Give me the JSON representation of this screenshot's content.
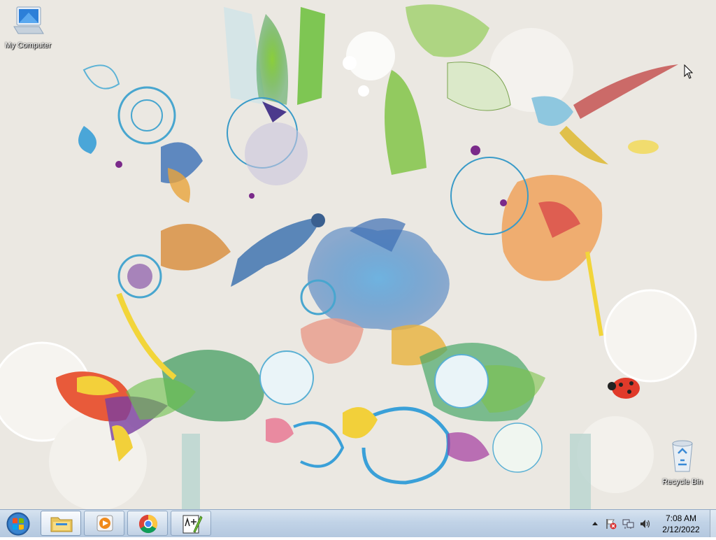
{
  "desktop": {
    "icons": [
      {
        "label": "My Computer"
      },
      {
        "label": "Recycle Bin"
      }
    ]
  },
  "taskbar": {
    "start": {
      "icon": "windows-logo-icon"
    },
    "pinned": [
      {
        "name": "Windows Explorer",
        "icon": "folder-icon",
        "active": true
      },
      {
        "name": "Windows Media Player",
        "icon": "media-player-icon",
        "active": false
      },
      {
        "name": "Google Chrome",
        "icon": "chrome-icon",
        "active": false
      },
      {
        "name": "Notepad++",
        "icon": "notepad-plus-icon",
        "active": false
      }
    ],
    "tray": {
      "icons": [
        "show-hidden-icons-arrow",
        "action-center-flag-icon",
        "network-icon",
        "volume-icon"
      ],
      "time": "7:08 AM",
      "date": "2/12/2022"
    }
  },
  "colors": {
    "taskbar_top": "#d7e3f0",
    "taskbar_bottom": "#b4c8df",
    "desktop_bg": "#ebe8e2"
  }
}
